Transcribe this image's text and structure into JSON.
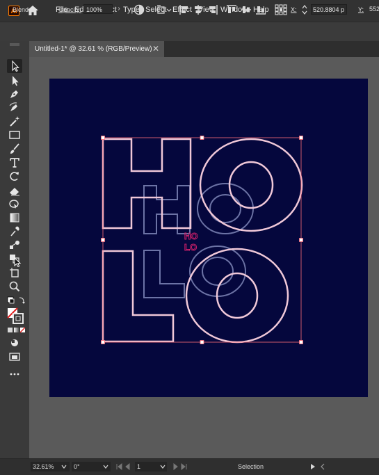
{
  "app": {
    "logo_text": "Ai",
    "menu": [
      "File",
      "Edit",
      "Object",
      "Type",
      "Select",
      "Effect",
      "View",
      "Window",
      "Help"
    ]
  },
  "control_bar": {
    "blend_label": "Blend",
    "opacity_label": "Opacity:",
    "opacity_value": "100%",
    "x_label": "X:",
    "x_value": "520.8804 p",
    "y_label": "Y:",
    "y_value": "552"
  },
  "document": {
    "tab_title": "Untitled-1* @ 32.61 % (RGB/Preview)",
    "close_glyph": "✕"
  },
  "artwork": {
    "letters": [
      "H",
      "O",
      "L",
      "O"
    ],
    "small_text": [
      "HO",
      "LO"
    ],
    "colors": {
      "artboard": "#05073d",
      "outline_main": "#f0c8d8",
      "outline_mid": "#7f86b8",
      "small_text": "#d0206a",
      "selection": "#ff6f79"
    }
  },
  "status_bar": {
    "zoom": "32.61%",
    "rotation": "0°",
    "artboard_number": "1",
    "tool_name": "Selection"
  },
  "icons": [
    "home-icon",
    "selection-tool-icon",
    "direct-selection-icon",
    "pen-tool-icon",
    "curvature-tool-icon",
    "magic-wand-icon",
    "rectangle-tool-icon",
    "paintbrush-icon",
    "type-tool-icon",
    "rotate-tool-icon",
    "eraser-tool-icon",
    "shape-builder-icon",
    "gradient-tool-icon",
    "eyedropper-icon",
    "blend-tool-icon",
    "artboard-tool-icon",
    "zoom-tool-icon",
    "fill-stroke-icon",
    "draw-mode-icon",
    "screen-mode-icon",
    "more-tools-icon"
  ]
}
